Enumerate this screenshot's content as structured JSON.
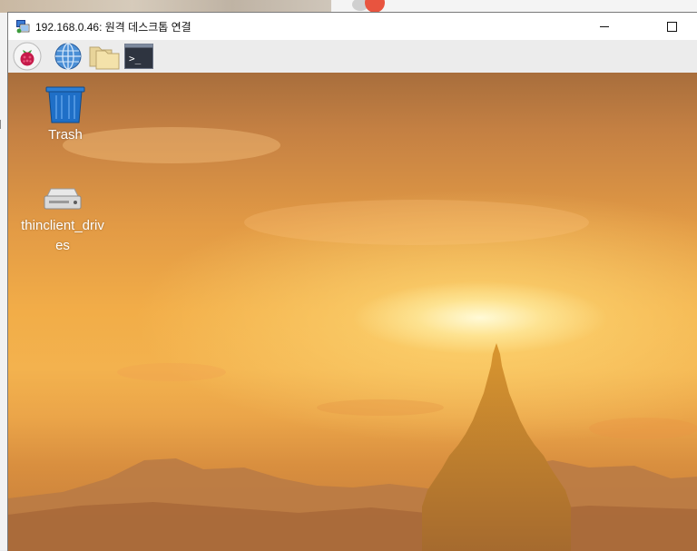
{
  "window": {
    "title": "192.168.0.46: 원격 데스크톱 연결",
    "app_icon": "remote-desktop-icon",
    "controls": {
      "minimize_icon": "minimize-icon",
      "maximize_icon": "maximize-icon"
    }
  },
  "panel": {
    "launchers": [
      {
        "icon": "raspberry-menu-icon"
      },
      {
        "icon": "globe-browser-icon"
      },
      {
        "icon": "folder-files-icon"
      },
      {
        "icon": "terminal-icon",
        "glyph": ">_"
      }
    ]
  },
  "desktop": {
    "icons": [
      {
        "icon": "trash-icon",
        "label": "Trash"
      },
      {
        "icon": "drive-icon",
        "label_line1": "thinclient_driv",
        "label_line2": "es"
      }
    ],
    "wallpaper": "sunset over pagoda"
  },
  "colors": {
    "panel_bg": "#ececec",
    "trash_blue": "#1f6fc7",
    "raspberry_red": "#c51a4a",
    "sky_orange": "#f2ad48"
  }
}
